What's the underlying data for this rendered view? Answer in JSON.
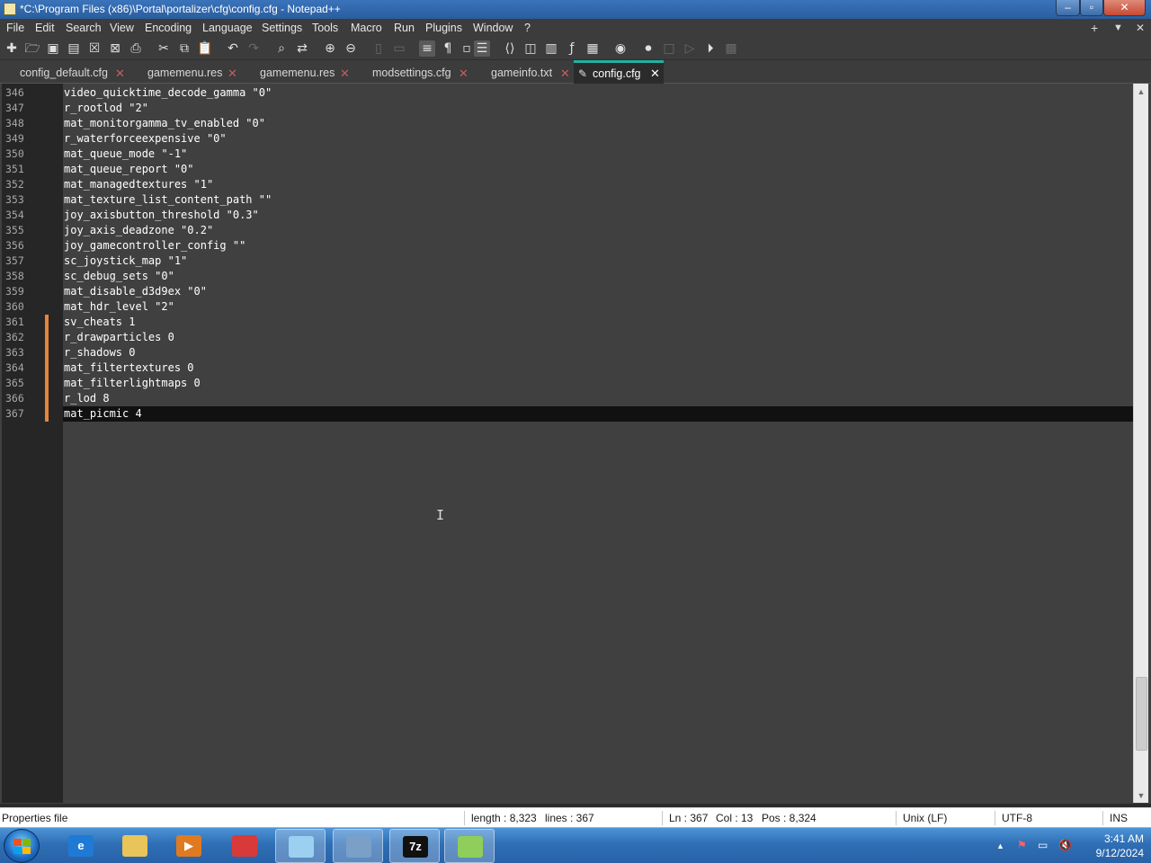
{
  "window": {
    "title": "*C:\\Program Files (x86)\\Portal\\portalizer\\cfg\\config.cfg - Notepad++",
    "minimize_glyph": "–",
    "maximize_glyph": "▫",
    "close_glyph": "✕"
  },
  "menu": {
    "items": [
      "File",
      "Edit",
      "Search",
      "View",
      "Encoding",
      "Language",
      "Settings",
      "Tools",
      "Macro",
      "Run",
      "Plugins",
      "Window",
      "?"
    ],
    "right_buttons": [
      "+",
      "▼",
      "✕"
    ]
  },
  "toolbar": {
    "icons": [
      "new-file-icon",
      "open-file-icon",
      "save-icon",
      "save-all-icon",
      "close-icon",
      "close-all-icon",
      "print-icon",
      "cut-icon",
      "copy-icon",
      "paste-icon",
      "undo-icon",
      "redo-icon",
      "find-icon",
      "replace-icon",
      "zoom-in-icon",
      "zoom-out-icon",
      "sync-vertical-icon",
      "sync-horizontal-icon",
      "word-wrap-icon",
      "show-all-characters-icon",
      "indent-guide-icon",
      "function-list-icon",
      "xml-tag-icon",
      "document-map-icon",
      "document-list-icon",
      "function-icon",
      "folder-workspace-icon",
      "monitoring-icon",
      "record-macro-icon",
      "stop-recording-icon",
      "playback-macro-icon",
      "run-macro-multiple-icon",
      "save-macro-icon"
    ]
  },
  "tabs": [
    {
      "label": "config_default.cfg",
      "active": false
    },
    {
      "label": "gamemenu.res",
      "active": false
    },
    {
      "label": "gamemenu.res",
      "active": false
    },
    {
      "label": "modsettings.cfg",
      "active": false
    },
    {
      "label": "gameinfo.txt",
      "active": false
    },
    {
      "label": "config.cfg",
      "active": true
    }
  ],
  "tab_close_glyph": "✕",
  "editor": {
    "lines": [
      {
        "num": "346",
        "text": "video_quicktime_decode_gamma \"0\"",
        "changed": false
      },
      {
        "num": "347",
        "text": "r_rootlod \"2\"",
        "changed": false
      },
      {
        "num": "348",
        "text": "mat_monitorgamma_tv_enabled \"0\"",
        "changed": false
      },
      {
        "num": "349",
        "text": "r_waterforceexpensive \"0\"",
        "changed": false
      },
      {
        "num": "350",
        "text": "mat_queue_mode \"-1\"",
        "changed": false
      },
      {
        "num": "351",
        "text": "mat_queue_report \"0\"",
        "changed": false
      },
      {
        "num": "352",
        "text": "mat_managedtextures \"1\"",
        "changed": false
      },
      {
        "num": "353",
        "text": "mat_texture_list_content_path \"\"",
        "changed": false
      },
      {
        "num": "354",
        "text": "joy_axisbutton_threshold \"0.3\"",
        "changed": false
      },
      {
        "num": "355",
        "text": "joy_axis_deadzone \"0.2\"",
        "changed": false
      },
      {
        "num": "356",
        "text": "joy_gamecontroller_config \"\"",
        "changed": false
      },
      {
        "num": "357",
        "text": "sc_joystick_map \"1\"",
        "changed": false
      },
      {
        "num": "358",
        "text": "sc_debug_sets \"0\"",
        "changed": false
      },
      {
        "num": "359",
        "text": "mat_disable_d3d9ex \"0\"",
        "changed": false
      },
      {
        "num": "360",
        "text": "mat_hdr_level \"2\"",
        "changed": false
      },
      {
        "num": "361",
        "text": "sv_cheats 1",
        "changed": true
      },
      {
        "num": "362",
        "text": "r_drawparticles 0",
        "changed": true
      },
      {
        "num": "363",
        "text": "r_shadows 0",
        "changed": true
      },
      {
        "num": "364",
        "text": "mat_filtertextures 0",
        "changed": true
      },
      {
        "num": "365",
        "text": "mat_filterlightmaps 0",
        "changed": true
      },
      {
        "num": "366",
        "text": "r_lod 8",
        "changed": true
      },
      {
        "num": "367",
        "text": "mat_picmic 4",
        "changed": true,
        "current": true
      }
    ]
  },
  "statusbar": {
    "file_type": "Properties file",
    "length": "length : 8,323",
    "lines": "lines : 367",
    "ln": "Ln : 367",
    "col": "Col : 13",
    "pos": "Pos : 8,324",
    "eol": "Unix (LF)",
    "encoding": "UTF-8",
    "mode": "INS"
  },
  "taskbar": {
    "apps": [
      {
        "name": "internet-explorer",
        "glyph": "e",
        "color": "#1f7ad6"
      },
      {
        "name": "file-explorer",
        "glyph": "",
        "color": "#e8c45a"
      },
      {
        "name": "media-player",
        "glyph": "▶",
        "color": "#e07a20"
      },
      {
        "name": "mail-app",
        "glyph": "",
        "color": "#d83a3a"
      },
      {
        "name": "notepad-app",
        "glyph": "",
        "color": "#9cd0f0"
      },
      {
        "name": "computer-app",
        "glyph": "",
        "color": "#7aa0c8"
      },
      {
        "name": "7zip-app",
        "glyph": "7z",
        "color": "#111111"
      },
      {
        "name": "notepadpp-app",
        "glyph": "",
        "color": "#8fce5a"
      }
    ],
    "tray_glyphs": [
      "▲",
      "⚑",
      "▭",
      "🔇"
    ],
    "time": "3:41 AM",
    "date": "9/12/2024"
  }
}
